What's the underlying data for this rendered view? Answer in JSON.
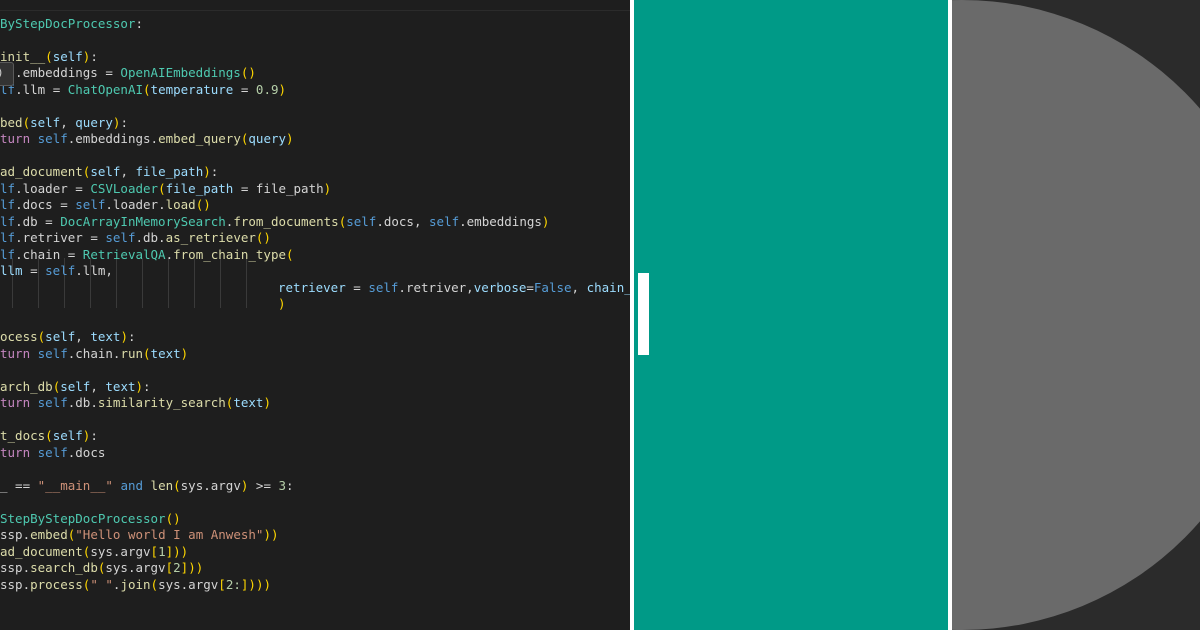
{
  "editor": {
    "tooltip_glyph": ")",
    "lines": [
      [
        {
          "t": "ByStepDocProcessor",
          "c": "cls"
        },
        {
          "t": ":",
          "c": "plain"
        }
      ],
      [],
      [
        {
          "t": "init__",
          "c": "fn"
        },
        {
          "t": "(",
          "c": "brk"
        },
        {
          "t": "self",
          "c": "param"
        },
        {
          "t": ")",
          "c": "brk"
        },
        {
          "t": ":",
          "c": "plain"
        }
      ],
      [
        {
          "t": "  .embeddings = ",
          "c": "plain"
        },
        {
          "t": "OpenAIEmbeddings",
          "c": "cls"
        },
        {
          "t": "()",
          "c": "brk"
        }
      ],
      [
        {
          "t": "lf",
          "c": "kw"
        },
        {
          "t": ".llm = ",
          "c": "plain"
        },
        {
          "t": "ChatOpenAI",
          "c": "cls"
        },
        {
          "t": "(",
          "c": "brk"
        },
        {
          "t": "temperature",
          "c": "param"
        },
        {
          "t": " = ",
          "c": "plain"
        },
        {
          "t": "0.9",
          "c": "num"
        },
        {
          "t": ")",
          "c": "brk"
        }
      ],
      [],
      [
        {
          "t": "bed",
          "c": "fn"
        },
        {
          "t": "(",
          "c": "brk"
        },
        {
          "t": "self",
          "c": "param"
        },
        {
          "t": ", ",
          "c": "plain"
        },
        {
          "t": "query",
          "c": "param"
        },
        {
          "t": ")",
          "c": "brk"
        },
        {
          "t": ":",
          "c": "plain"
        }
      ],
      [
        {
          "t": "turn",
          "c": "ctrl"
        },
        {
          "t": " ",
          "c": "plain"
        },
        {
          "t": "self",
          "c": "kw"
        },
        {
          "t": ".embeddings.",
          "c": "plain"
        },
        {
          "t": "embed_query",
          "c": "fn"
        },
        {
          "t": "(",
          "c": "brk"
        },
        {
          "t": "query",
          "c": "param"
        },
        {
          "t": ")",
          "c": "brk"
        }
      ],
      [],
      [
        {
          "t": "ad_document",
          "c": "fn"
        },
        {
          "t": "(",
          "c": "brk"
        },
        {
          "t": "self",
          "c": "param"
        },
        {
          "t": ", ",
          "c": "plain"
        },
        {
          "t": "file_path",
          "c": "param"
        },
        {
          "t": ")",
          "c": "brk"
        },
        {
          "t": ":",
          "c": "plain"
        }
      ],
      [
        {
          "t": "lf",
          "c": "kw"
        },
        {
          "t": ".loader = ",
          "c": "plain"
        },
        {
          "t": "CSVLoader",
          "c": "cls"
        },
        {
          "t": "(",
          "c": "brk"
        },
        {
          "t": "file_path",
          "c": "param"
        },
        {
          "t": " = file_path",
          "c": "plain"
        },
        {
          "t": ")",
          "c": "brk"
        }
      ],
      [
        {
          "t": "lf",
          "c": "kw"
        },
        {
          "t": ".docs = ",
          "c": "plain"
        },
        {
          "t": "self",
          "c": "kw"
        },
        {
          "t": ".loader.",
          "c": "plain"
        },
        {
          "t": "load",
          "c": "fn"
        },
        {
          "t": "()",
          "c": "brk"
        }
      ],
      [
        {
          "t": "lf",
          "c": "kw"
        },
        {
          "t": ".db = ",
          "c": "plain"
        },
        {
          "t": "DocArrayInMemorySearch",
          "c": "cls"
        },
        {
          "t": ".",
          "c": "plain"
        },
        {
          "t": "from_documents",
          "c": "fn"
        },
        {
          "t": "(",
          "c": "brk"
        },
        {
          "t": "self",
          "c": "kw"
        },
        {
          "t": ".docs, ",
          "c": "plain"
        },
        {
          "t": "self",
          "c": "kw"
        },
        {
          "t": ".embeddings",
          "c": "plain"
        },
        {
          "t": ")",
          "c": "brk"
        }
      ],
      [
        {
          "t": "lf",
          "c": "kw"
        },
        {
          "t": ".retriver = ",
          "c": "plain"
        },
        {
          "t": "self",
          "c": "kw"
        },
        {
          "t": ".db.",
          "c": "plain"
        },
        {
          "t": "as_retriever",
          "c": "fn"
        },
        {
          "t": "()",
          "c": "brk"
        }
      ],
      [
        {
          "t": "lf",
          "c": "kw"
        },
        {
          "t": ".chain = ",
          "c": "plain"
        },
        {
          "t": "RetrievalQA",
          "c": "cls"
        },
        {
          "t": ".",
          "c": "plain"
        },
        {
          "t": "from_chain_type",
          "c": "fn"
        },
        {
          "t": "(",
          "c": "brk"
        }
      ],
      [
        {
          "t": "llm",
          "c": "param"
        },
        {
          "t": " = ",
          "c": "plain"
        },
        {
          "t": "self",
          "c": "kw"
        },
        {
          "t": ".llm,",
          "c": "plain"
        }
      ],
      [
        {
          "t": "retriever",
          "c": "param"
        },
        {
          "t": " = ",
          "c": "plain"
        },
        {
          "t": "self",
          "c": "kw"
        },
        {
          "t": ".retriver,",
          "c": "plain"
        },
        {
          "t": "verbose",
          "c": "param"
        },
        {
          "t": "=",
          "c": "plain"
        },
        {
          "t": "False",
          "c": "kw"
        },
        {
          "t": ", ",
          "c": "plain"
        },
        {
          "t": "chain_type",
          "c": "param"
        },
        {
          "t": " =",
          "c": "plain"
        }
      ],
      [
        {
          "t": ")",
          "c": "brk"
        }
      ],
      [],
      [
        {
          "t": "ocess",
          "c": "fn"
        },
        {
          "t": "(",
          "c": "brk"
        },
        {
          "t": "self",
          "c": "param"
        },
        {
          "t": ", ",
          "c": "plain"
        },
        {
          "t": "text",
          "c": "param"
        },
        {
          "t": ")",
          "c": "brk"
        },
        {
          "t": ":",
          "c": "plain"
        }
      ],
      [
        {
          "t": "turn",
          "c": "ctrl"
        },
        {
          "t": " ",
          "c": "plain"
        },
        {
          "t": "self",
          "c": "kw"
        },
        {
          "t": ".chain.",
          "c": "plain"
        },
        {
          "t": "run",
          "c": "fn"
        },
        {
          "t": "(",
          "c": "brk"
        },
        {
          "t": "text",
          "c": "param"
        },
        {
          "t": ")",
          "c": "brk"
        }
      ],
      [],
      [
        {
          "t": "arch_db",
          "c": "fn"
        },
        {
          "t": "(",
          "c": "brk"
        },
        {
          "t": "self",
          "c": "param"
        },
        {
          "t": ", ",
          "c": "plain"
        },
        {
          "t": "text",
          "c": "param"
        },
        {
          "t": ")",
          "c": "brk"
        },
        {
          "t": ":",
          "c": "plain"
        }
      ],
      [
        {
          "t": "turn",
          "c": "ctrl"
        },
        {
          "t": " ",
          "c": "plain"
        },
        {
          "t": "self",
          "c": "kw"
        },
        {
          "t": ".db.",
          "c": "plain"
        },
        {
          "t": "similarity_search",
          "c": "fn"
        },
        {
          "t": "(",
          "c": "brk"
        },
        {
          "t": "text",
          "c": "param"
        },
        {
          "t": ")",
          "c": "brk"
        }
      ],
      [],
      [
        {
          "t": "t_docs",
          "c": "fn"
        },
        {
          "t": "(",
          "c": "brk"
        },
        {
          "t": "self",
          "c": "param"
        },
        {
          "t": ")",
          "c": "brk"
        },
        {
          "t": ":",
          "c": "plain"
        }
      ],
      [
        {
          "t": "turn",
          "c": "ctrl"
        },
        {
          "t": " ",
          "c": "plain"
        },
        {
          "t": "self",
          "c": "kw"
        },
        {
          "t": ".docs",
          "c": "plain"
        }
      ],
      [],
      [
        {
          "t": "_ == ",
          "c": "plain"
        },
        {
          "t": "\"__main__\"",
          "c": "str"
        },
        {
          "t": " ",
          "c": "plain"
        },
        {
          "t": "and",
          "c": "kw"
        },
        {
          "t": " ",
          "c": "plain"
        },
        {
          "t": "len",
          "c": "fn"
        },
        {
          "t": "(",
          "c": "brk"
        },
        {
          "t": "sys.argv",
          "c": "plain"
        },
        {
          "t": ")",
          "c": "brk"
        },
        {
          "t": " >= ",
          "c": "plain"
        },
        {
          "t": "3",
          "c": "num"
        },
        {
          "t": ":",
          "c": "plain"
        }
      ],
      [],
      [
        {
          "t": "StepByStepDocProcessor",
          "c": "cls"
        },
        {
          "t": "()",
          "c": "brk"
        }
      ],
      [
        {
          "t": "ssp.",
          "c": "plain"
        },
        {
          "t": "embed",
          "c": "fn"
        },
        {
          "t": "(",
          "c": "brk"
        },
        {
          "t": "\"Hello world I am Anwesh\"",
          "c": "str"
        },
        {
          "t": "))",
          "c": "brk"
        }
      ],
      [
        {
          "t": "ad_document",
          "c": "fn"
        },
        {
          "t": "(",
          "c": "brk"
        },
        {
          "t": "sys.argv",
          "c": "plain"
        },
        {
          "t": "[",
          "c": "brk"
        },
        {
          "t": "1",
          "c": "num"
        },
        {
          "t": "]",
          "c": "brk"
        },
        {
          "t": "))",
          "c": "brk"
        }
      ],
      [
        {
          "t": "ssp.",
          "c": "plain"
        },
        {
          "t": "search_db",
          "c": "fn"
        },
        {
          "t": "(",
          "c": "brk"
        },
        {
          "t": "sys.argv",
          "c": "plain"
        },
        {
          "t": "[",
          "c": "brk"
        },
        {
          "t": "2",
          "c": "num"
        },
        {
          "t": "]",
          "c": "brk"
        },
        {
          "t": "))",
          "c": "brk"
        }
      ],
      [
        {
          "t": "ssp.",
          "c": "plain"
        },
        {
          "t": "process",
          "c": "fn"
        },
        {
          "t": "(",
          "c": "brk"
        },
        {
          "t": "\" \"",
          "c": "str"
        },
        {
          "t": ".",
          "c": "plain"
        },
        {
          "t": "join",
          "c": "fn"
        },
        {
          "t": "(",
          "c": "brk"
        },
        {
          "t": "sys.argv",
          "c": "plain"
        },
        {
          "t": "[",
          "c": "brk"
        },
        {
          "t": "2:",
          "c": "num"
        },
        {
          "t": "]",
          "c": "brk"
        },
        {
          "t": ")))",
          "c": "brk"
        }
      ]
    ]
  },
  "colors": {
    "editor_bg": "#1e1e1e",
    "teal": "#009a87",
    "dark_panel": "#2b2b2b",
    "half_circle": "#6a6a6a",
    "keyword": "#569cd6",
    "control": "#c586c0",
    "function": "#dcdcaa",
    "class": "#4ec9b0",
    "param": "#9cdcfe",
    "string": "#ce9178",
    "number": "#b5cea8",
    "bracket": "#ffd700"
  }
}
